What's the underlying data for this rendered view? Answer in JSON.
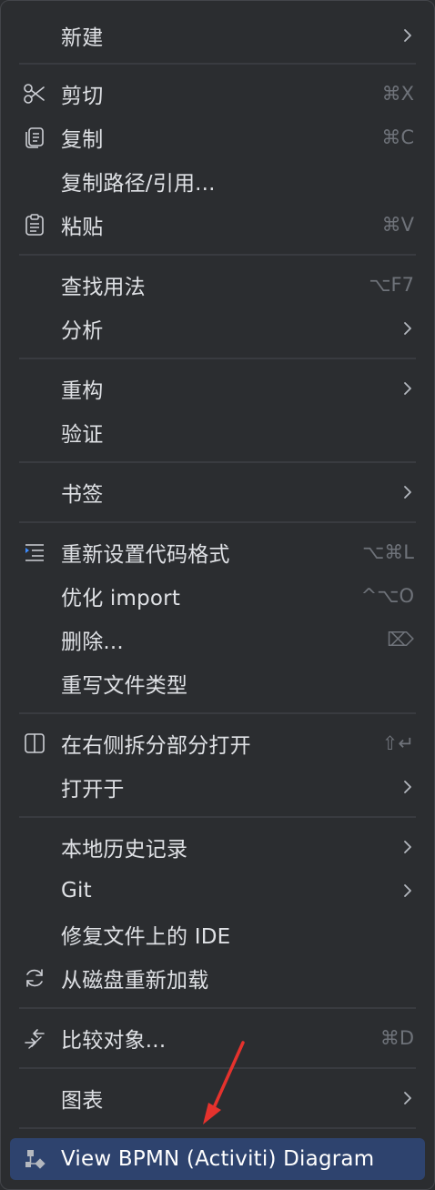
{
  "menu": {
    "items": [
      {
        "label": "新建",
        "shortcut": "",
        "icon": "",
        "submenu": true
      },
      {
        "label": "剪切",
        "shortcut": "⌘X",
        "icon": "scissors-icon",
        "submenu": false
      },
      {
        "label": "复制",
        "shortcut": "⌘C",
        "icon": "copy-icon",
        "submenu": false
      },
      {
        "label": "复制路径/引用...",
        "shortcut": "",
        "icon": "",
        "submenu": false
      },
      {
        "label": "粘贴",
        "shortcut": "⌘V",
        "icon": "paste-icon",
        "submenu": false
      },
      {
        "label": "查找用法",
        "shortcut": "⌥F7",
        "icon": "",
        "submenu": false
      },
      {
        "label": "分析",
        "shortcut": "",
        "icon": "",
        "submenu": true
      },
      {
        "label": "重构",
        "shortcut": "",
        "icon": "",
        "submenu": true
      },
      {
        "label": "验证",
        "shortcut": "",
        "icon": "",
        "submenu": false
      },
      {
        "label": "书签",
        "shortcut": "",
        "icon": "",
        "submenu": true
      },
      {
        "label": "重新设置代码格式",
        "shortcut": "⌥⌘L",
        "icon": "reformat-icon",
        "submenu": false
      },
      {
        "label": "优化 import",
        "shortcut": "^⌥O",
        "icon": "",
        "submenu": false
      },
      {
        "label": "删除...",
        "shortcut": "⌦",
        "icon": "",
        "submenu": false
      },
      {
        "label": "重写文件类型",
        "shortcut": "",
        "icon": "",
        "submenu": false
      },
      {
        "label": "在右侧拆分部分打开",
        "shortcut": "⇧↵",
        "icon": "split-icon",
        "submenu": false
      },
      {
        "label": "打开于",
        "shortcut": "",
        "icon": "",
        "submenu": true
      },
      {
        "label": "本地历史记录",
        "shortcut": "",
        "icon": "",
        "submenu": true
      },
      {
        "label": "Git",
        "shortcut": "",
        "icon": "",
        "submenu": true
      },
      {
        "label": "修复文件上的 IDE",
        "shortcut": "",
        "icon": "",
        "submenu": false
      },
      {
        "label": "从磁盘重新加载",
        "shortcut": "",
        "icon": "reload-icon",
        "submenu": false
      },
      {
        "label": "比较对象...",
        "shortcut": "⌘D",
        "icon": "compare-icon",
        "submenu": false
      },
      {
        "label": "图表",
        "shortcut": "",
        "icon": "",
        "submenu": true
      },
      {
        "label": "View BPMN (Activiti) Diagram",
        "shortcut": "",
        "icon": "bpmn-diagram-icon",
        "submenu": false,
        "selected": true
      }
    ]
  },
  "colors": {
    "background": "#2b2d30",
    "selection": "#2e436e",
    "text": "#dfe1e5",
    "shortcut": "#6f737a",
    "annotation_arrow": "#e5322d"
  }
}
